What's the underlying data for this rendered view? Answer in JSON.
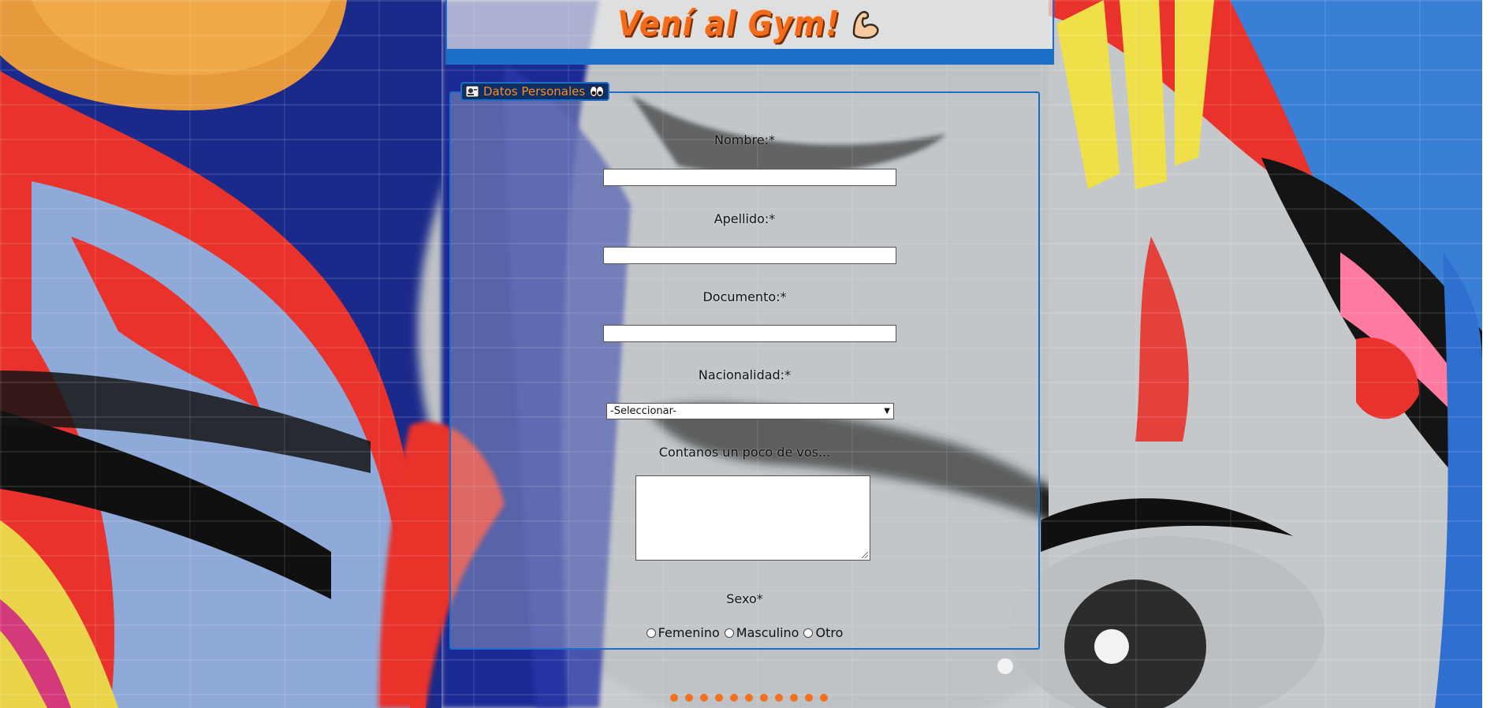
{
  "header": {
    "logo_text": "Vení al Gym!",
    "logo_icon": "flexed-biceps-icon"
  },
  "form": {
    "legend": {
      "label": "Datos Personales",
      "left_icon": "id-card-icon",
      "right_icon": "eyes-icon"
    },
    "nombre_label": "Nombre:*",
    "nombre_value": "",
    "apellido_label": "Apellido:*",
    "apellido_value": "",
    "documento_label": "Documento:*",
    "documento_value": "",
    "nacionalidad_label": "Nacionalidad:*",
    "nacionalidad_selected": "-Seleccionar-",
    "about_label": "Contanos un poco de vos...",
    "about_value": "",
    "sexo_label": "Sexo*",
    "sexo_options": [
      "Femenino",
      "Masculino",
      "Otro"
    ]
  },
  "colors": {
    "accent_blue": "#1b6fc7",
    "legend_bg": "#0d2f66",
    "logo_orange": "#f26a1b",
    "dot_orange": "#f2701e"
  }
}
